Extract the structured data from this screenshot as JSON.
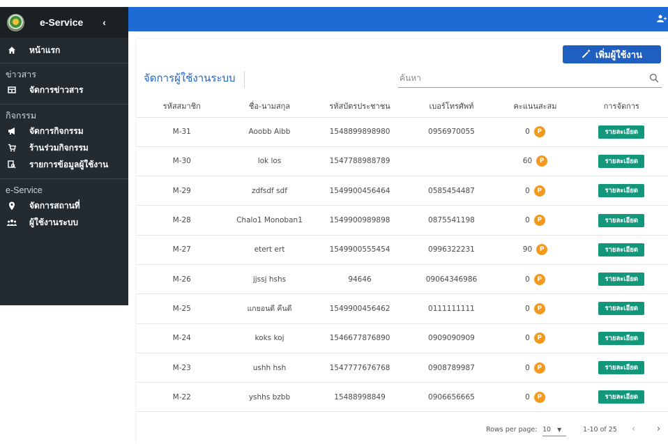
{
  "sidebar": {
    "brand": "e-Service",
    "collapse": "‹",
    "home": "หน้าแรก",
    "sections": {
      "news": "ข่าวสาร",
      "activities": "กิจกรรม",
      "eservice": "e-Service"
    },
    "items": {
      "manage_news": "จัดการข่าวสาร",
      "manage_activities": "จัดการกิจกรรม",
      "shop_activities": "ร้านร่วมกิจกรรม",
      "user_data": "รายการข้อมูลผู้ใช้งาน",
      "manage_places": "จัดการสถานที่",
      "system_users": "ผู้ใช้งานระบบ"
    }
  },
  "header": {
    "accent": "#1f6bd6"
  },
  "main": {
    "add_button": "เพิ่มผู้ใช้งาน",
    "title": "จัดการผู้ใช้งานระบบ",
    "search_placeholder": "ค้นหา",
    "columns": [
      "รหัสสมาชิก",
      "ชื่อ-นามสกุล",
      "รหัสบัตรประชาชน",
      "เบอร์โทรศัพท์",
      "คะแนนสะสม",
      "การจัดการ"
    ],
    "detail_label": "รายละเอียด",
    "points_badge": "P",
    "rows": [
      {
        "id": "M-31",
        "name": "Aoobb Aibb",
        "citizen": "1548899898980",
        "phone": "0956970055",
        "points": "0"
      },
      {
        "id": "M-30",
        "name": "lok los",
        "citizen": "1547788988789",
        "phone": "",
        "points": "60"
      },
      {
        "id": "M-29",
        "name": "zdfsdf sdf",
        "citizen": "1549900456464",
        "phone": "0585454487",
        "points": "0"
      },
      {
        "id": "M-28",
        "name": "Chalo1 Monoban1",
        "citizen": "1549900989898",
        "phone": "0875541198",
        "points": "0"
      },
      {
        "id": "M-27",
        "name": "etert ert",
        "citizen": "1549900555454",
        "phone": "0996322231",
        "points": "90"
      },
      {
        "id": "M-26",
        "name": "jjssj hshs",
        "citizen": "94646",
        "phone": "09064346986",
        "points": "0"
      },
      {
        "id": "M-25",
        "name": "แกยอนดี คืนดี",
        "citizen": "1549900456462",
        "phone": "0111111111",
        "points": "0"
      },
      {
        "id": "M-24",
        "name": "koks koj",
        "citizen": "1546677876890",
        "phone": "0909090909",
        "points": "0"
      },
      {
        "id": "M-23",
        "name": "ushh hsh",
        "citizen": "1547777676768",
        "phone": "0908789987",
        "points": "0"
      },
      {
        "id": "M-22",
        "name": "yshhs bzbb",
        "citizen": "15488998849",
        "phone": "0906656665",
        "points": "0"
      }
    ],
    "pagination": {
      "rows_per_page_label": "Rows per page:",
      "rows_per_page": "10",
      "range": "1-10 of 25",
      "prev": "‹",
      "next": "›"
    }
  }
}
